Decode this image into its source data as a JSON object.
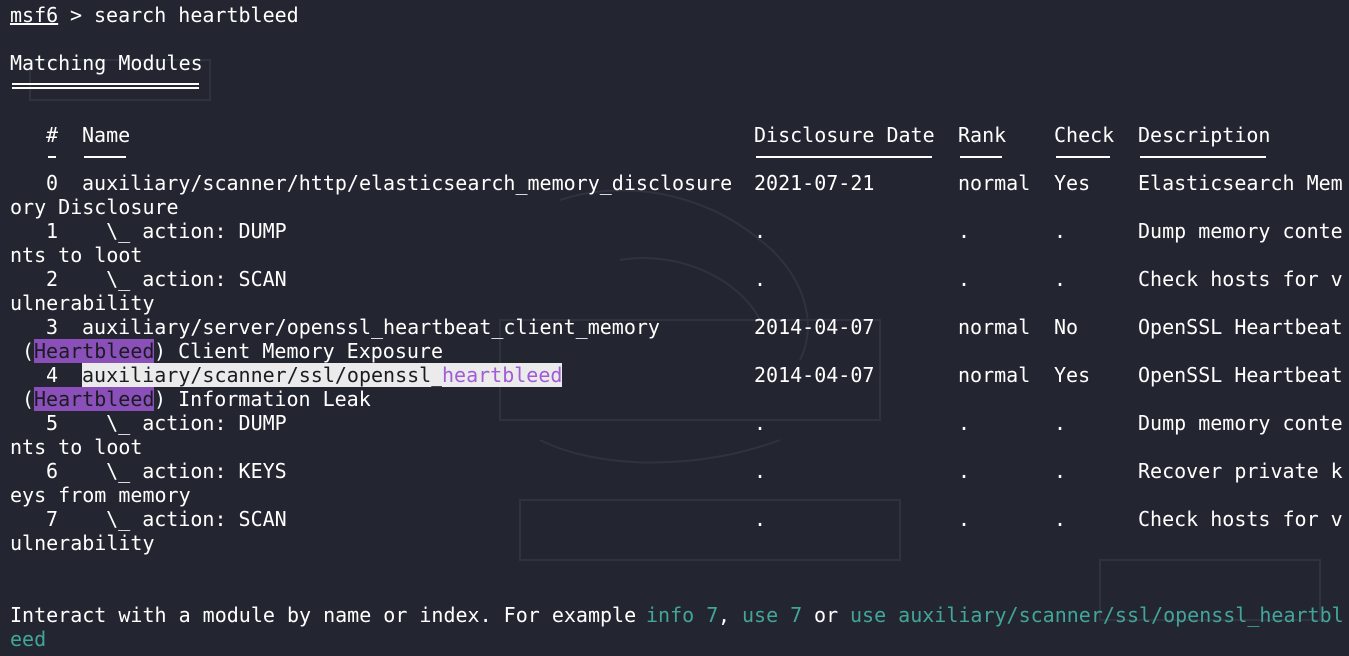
{
  "prompt": {
    "user": "msf6",
    "symbol": " > ",
    "command": "search heartbleed"
  },
  "section_title": "Matching Modules",
  "columns": {
    "index": "#",
    "name": "Name",
    "disclosure_date": "Disclosure Date",
    "rank": "Rank",
    "check": "Check",
    "description": "Description"
  },
  "rows": [
    {
      "index": "0",
      "name": "auxiliary/scanner/http/elasticsearch_memory_disclosure",
      "date": "2021-07-21",
      "rank": "normal",
      "check": "Yes",
      "desc_head": "Elasticsearch Mem",
      "desc_wrap": "ory Disclosure"
    },
    {
      "index": "1",
      "name": "  \\_ action: DUMP",
      "date": ".",
      "rank": ".",
      "check": ".",
      "desc_head": "Dump memory conte",
      "desc_wrap": "nts to loot"
    },
    {
      "index": "2",
      "name": "  \\_ action: SCAN",
      "date": ".",
      "rank": ".",
      "check": ".",
      "desc_head": "Check hosts for v",
      "desc_wrap": "ulnerability"
    },
    {
      "index": "3",
      "name": "auxiliary/server/openssl_heartbeat_client_memory",
      "date": "2014-04-07",
      "rank": "normal",
      "check": "No",
      "desc_head": "OpenSSL Heartbeat",
      "desc_wrap_open": " (",
      "desc_wrap_hl": "Heartbleed",
      "desc_wrap_rest": ") Client Memory Exposure"
    },
    {
      "index": "4",
      "name_prefix": "auxiliary/scanner/ssl/openssl_",
      "name_hl": "heartbleed",
      "date": "2014-04-07",
      "rank": "normal",
      "check": "Yes",
      "desc_head": "OpenSSL Heartbeat",
      "desc_wrap_open": " (",
      "desc_wrap_hl": "Heartbleed",
      "desc_wrap_rest": ") Information Leak"
    },
    {
      "index": "5",
      "name": "  \\_ action: DUMP",
      "date": ".",
      "rank": ".",
      "check": ".",
      "desc_head": "Dump memory conte",
      "desc_wrap": "nts to loot"
    },
    {
      "index": "6",
      "name": "  \\_ action: KEYS",
      "date": ".",
      "rank": ".",
      "check": ".",
      "desc_head": "Recover private k",
      "desc_wrap": "eys from memory"
    },
    {
      "index": "7",
      "name": "  \\_ action: SCAN",
      "date": ".",
      "rank": ".",
      "check": ".",
      "desc_head": "Check hosts for v",
      "desc_wrap": "ulnerability"
    }
  ],
  "footer": {
    "text1": "Interact with a module by name or index. For example ",
    "example1": "info 7",
    "sep1": ", ",
    "example2": "use 7",
    "sep2": " or ",
    "example3_head": "use auxiliary/scanner/ssl/openssl_heartbl",
    "example3_wrap": "eed"
  },
  "colors": {
    "background": "#232630",
    "foreground": "#ffffff",
    "highlight_purple": "#8a4fb8",
    "teal_link": "#42a59a"
  }
}
